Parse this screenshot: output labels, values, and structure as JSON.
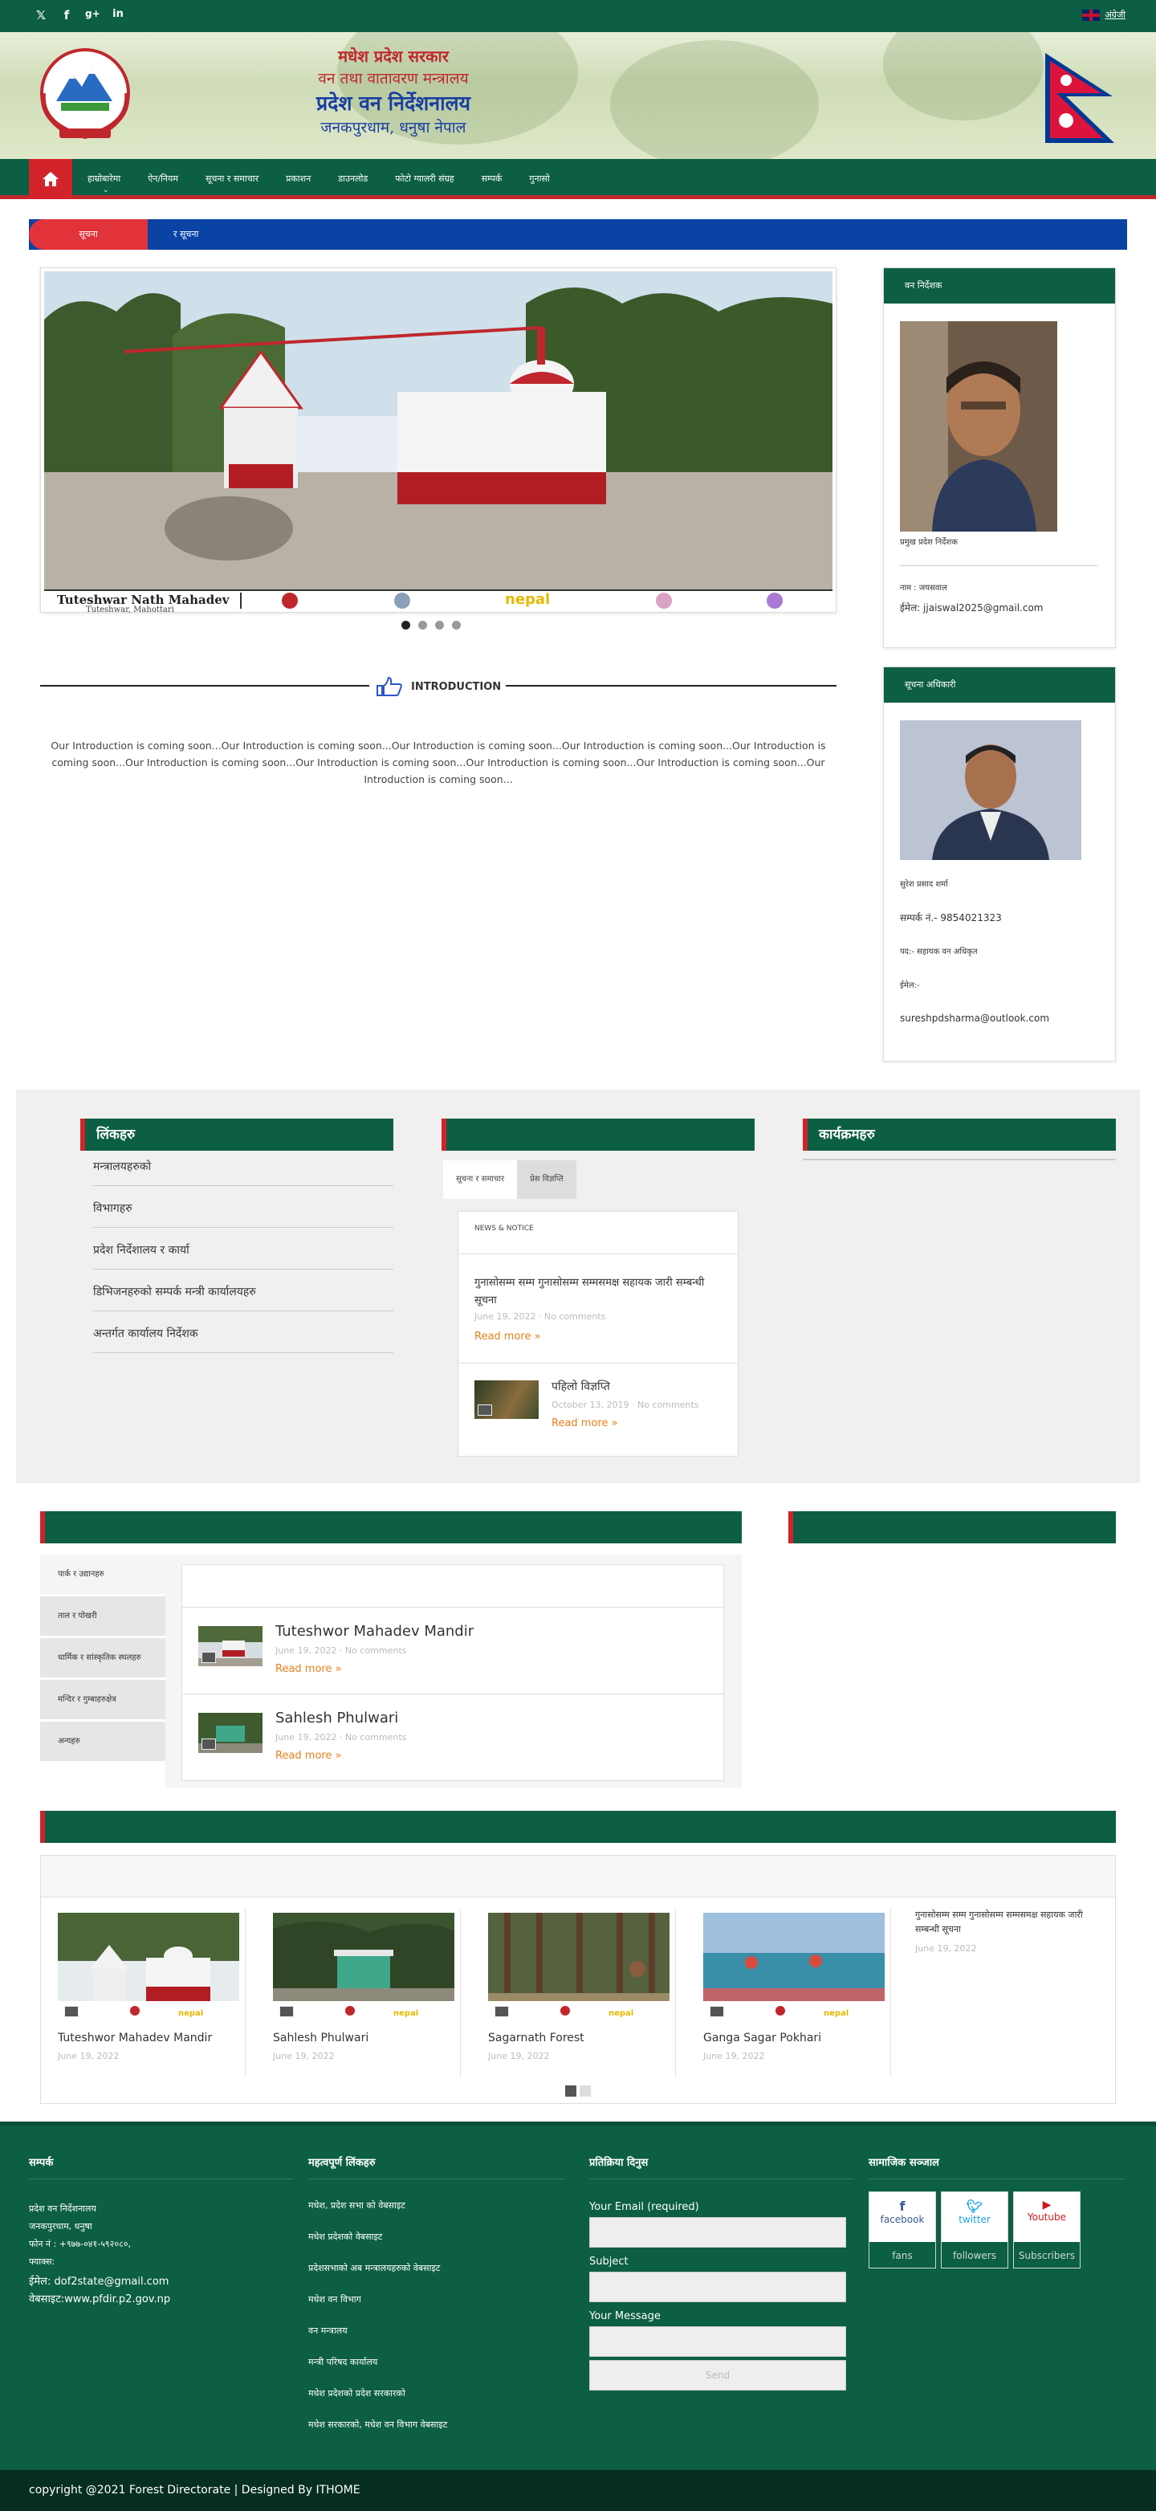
{
  "topbar": {
    "social": [
      "twitter-icon",
      "facebook-icon",
      "google-plus-icon",
      "linkedin-icon"
    ],
    "lang_label": "अंग्रेजी"
  },
  "header": {
    "line1": "मधेश प्रदेश सरकार",
    "line2": "वन तथा वातावरण मन्त्रालय",
    "line3": "प्रदेश वन निर्देशनालय",
    "line4": "जनकपुरधाम, धनुषा नेपाल"
  },
  "nav": {
    "items": [
      "हाम्रोबारेमा",
      "ऐन/नियम",
      "सूचना र समाचार",
      "प्रकाशन",
      "डाउनलोड",
      "फोटो ग्यालरी संग्रह",
      "सम्पर्क",
      "गुनासो"
    ]
  },
  "ticker": {
    "label": "सूचना",
    "message": "र सूचना"
  },
  "slider": {
    "caption": "Tuteshwar Nath Mahadev",
    "subcaption": "Tuteshwar, Mahottari",
    "strip_text": "nepal",
    "dots": 4,
    "active_dot": 0
  },
  "intro": {
    "heading": "INTRODUCTION",
    "text": "Our Introduction is coming soon...Our Introduction is coming soon...Our Introduction is coming soon...Our Introduction is coming soon...Our Introduction is coming soon...Our Introduction is coming soon...Our Introduction is coming soon...Our Introduction is coming soon...Our Introduction is coming soon...Our Introduction is coming soon..."
  },
  "director": {
    "heading": "वन निर्देशक",
    "name": "प्रमुख प्रदेश निर्देशक",
    "role": "नाम : जयसवाल",
    "email": "ईमेल: jjaiswal2025@gmail.com"
  },
  "info_officer": {
    "heading": "सूचना अधिकारी",
    "name": "सुरेश प्रसाद शर्मा",
    "phone": "सम्पर्क नं.- 9854021323",
    "post": "पद:- सहायक वन अधिकृत",
    "email_label": "ईमेल:-",
    "email": "sureshpdsharma@outlook.com"
  },
  "links_col": {
    "heading": "लिंकहरु",
    "items": [
      "मन्त्रालयहरुको",
      "विभागहरु",
      "प्रदेश निर्देशालय र कार्या",
      "डिभिजनहरुको सम्पर्क मन्त्री कार्यालयहरु",
      "अन्तर्गत कार्यालय निर्देशक"
    ]
  },
  "news_col": {
    "heading": "",
    "tabs": [
      "सूचना र समाचार",
      "प्रेस विज्ञप्ति"
    ],
    "panel_label": "NEWS & NOTICE",
    "post1_title": "गुनासोसम्म सम्म गुनासोसम्म सम्मसमक्ष सहायक जारी सम्बन्धी सूचना",
    "post1_meta": "June 19, 2022  ·  No comments",
    "post2_title": "पहिलो विज्ञप्ति",
    "post2_meta": "October 13, 2019  ·  No comments",
    "read_more": "Read more »"
  },
  "third_col": {
    "heading": "कार्यक्रमहरु"
  },
  "gallery_tabs": {
    "vtabs": [
      "पार्क र उद्यानहरु",
      "ताल र पोखरी",
      "धार्मिक र सांस्कृतिक स्थलहरु",
      "मन्दिर र गुम्बाहरुक्षेत्र",
      "अन्यहरु"
    ],
    "post1_title": "Tuteshwor Mahadev Mandir",
    "post1_meta": "June 19, 2022  ·  No comments",
    "post2_title": "Sahlesh Phulwari",
    "post2_meta": "June 19, 2022  ·  No comments",
    "read_more": "Read more »"
  },
  "carousel": {
    "items": [
      {
        "title": "Tuteshwor Mahadev Mandir",
        "date": "June 19, 2022"
      },
      {
        "title": "Sahlesh Phulwari",
        "date": "June 19, 2022"
      },
      {
        "title": "Sagarnath Forest",
        "date": "June 19, 2022"
      },
      {
        "title": "Ganga Sagar Pokhari",
        "date": "June 19, 2022"
      }
    ],
    "last_title": "गुनासोसम्म सम्म गुनासोसम्म सम्मसमक्ष सहायक जारी सम्बन्धी सूचना",
    "last_date": "June 19, 2022",
    "pages": 2,
    "active_page": 0
  },
  "footer": {
    "col1_heading": "सम्पर्क",
    "col1_lines": [
      "प्रदेश वन निर्देशनालय",
      "जनकपुरधाम, धनुषा",
      "फोन नं : +९७७-०४१-५९२०८०,",
      "फ्याक्स:",
      "ईमेल: dof2state@gmail.com",
      "वेबसाइट:www.pfdir.p2.gov.np"
    ],
    "col2_heading": "महत्वपूर्ण लिंकहरु",
    "col2_links": [
      "मधेश, प्रदेश सभा  को वेबसाइट",
      "मधेश प्रदेशको वेबसाइट",
      "प्रदेशसभाको अब मन्त्रालयहरुको वेबसाइट",
      "मधेश वन विभाग",
      "वन मन्त्रालय",
      "मन्त्री परिषद कार्यालय",
      "मधेश प्रदेशको प्रदेश सरकारको",
      "मधेश सरकारको, मधेश वन विभाग वेबसाइट"
    ],
    "col3_heading": "प्रतिक्रिया दिनुस",
    "email_label": "Your Email (required)",
    "subject_label": "Subject",
    "message_label": "Your Message",
    "send_label": "Send",
    "col4_heading": "सामाजिक सञ्जाल",
    "social": [
      {
        "name": "facebook",
        "count_label": "fans",
        "color": "#3b5998"
      },
      {
        "name": "twitter",
        "count_label": "followers",
        "color": "#1da1f2"
      },
      {
        "name": "Youtube",
        "count_label": "Subscribers",
        "color": "#cc181e"
      }
    ]
  },
  "copyright": "copyright @2021 Forest Directorate | Designed By ITHOME"
}
